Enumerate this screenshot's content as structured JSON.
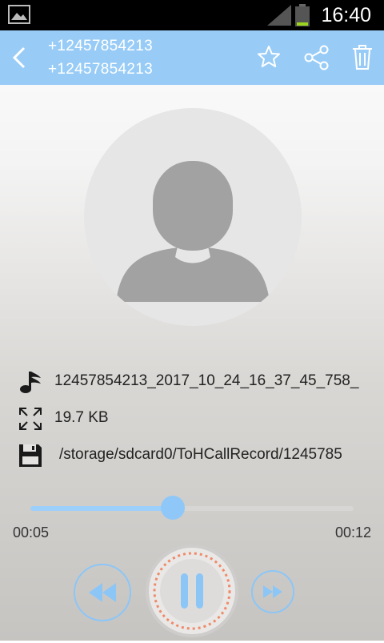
{
  "status_bar": {
    "time": "16:40"
  },
  "header": {
    "number_primary": "+12457854213",
    "number_secondary": "+12457854213",
    "back_icon": "chevron-left-icon",
    "actions": [
      "star-icon",
      "share-icon",
      "trash-icon"
    ]
  },
  "recording": {
    "file_name": "12457854213_2017_10_24_16_37_45_758_",
    "file_size": "19.7 KB",
    "file_path": "/storage/sdcard0/ToHCallRecord/1245785"
  },
  "player": {
    "current_time": "00:05",
    "total_time": "00:12",
    "progress": 0.44,
    "state": "playing"
  },
  "colors": {
    "accent": "#98ccf7",
    "status_bar": "#000000",
    "play_ring": "#ee8a6a"
  }
}
